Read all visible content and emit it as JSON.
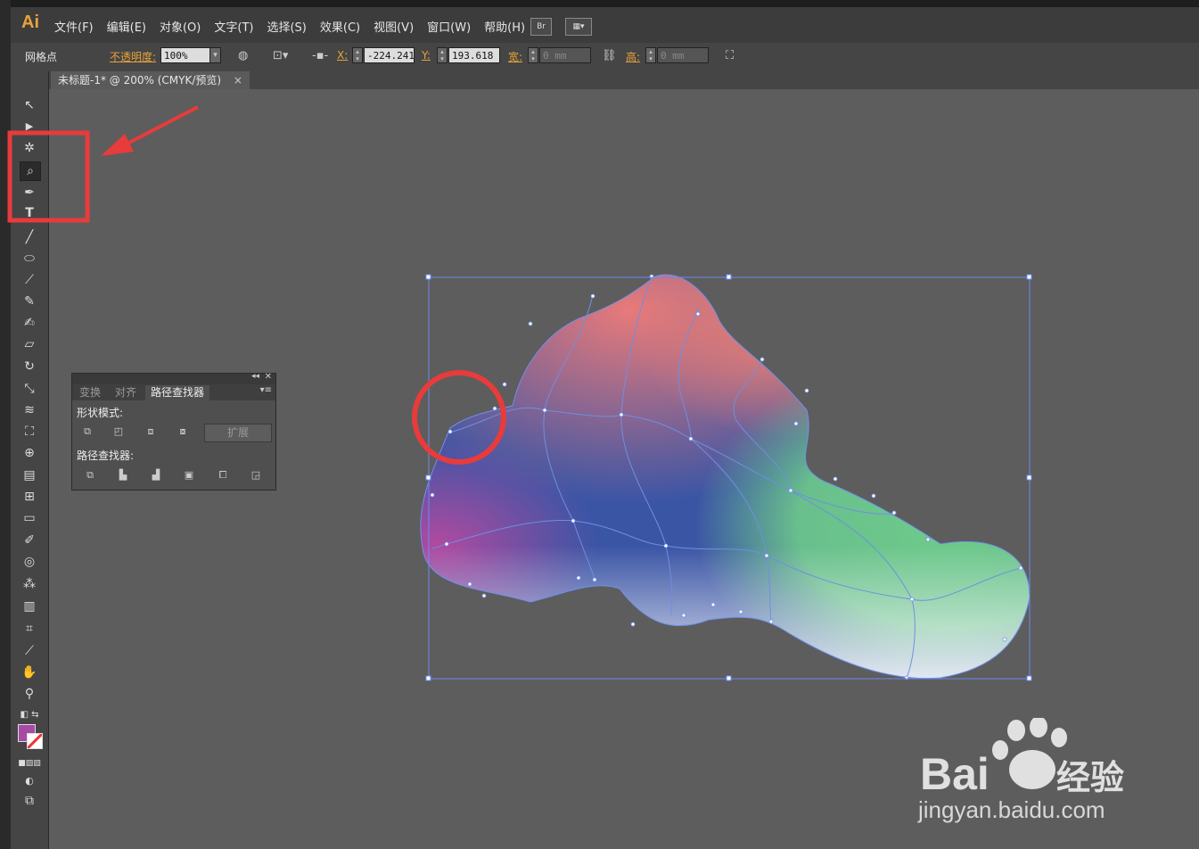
{
  "app": {
    "logo": "Ai"
  },
  "menu": [
    "文件(F)",
    "编辑(E)",
    "对象(O)",
    "文字(T)",
    "选择(S)",
    "效果(C)",
    "视图(V)",
    "窗口(W)",
    "帮助(H)"
  ],
  "menu_icons": {
    "bridge": "Br",
    "arrange": "arrange-documents-icon"
  },
  "control": {
    "selection_label": "网格点",
    "opacity_label": "不透明度:",
    "opacity_value": "100%",
    "x_label": "X:",
    "x_value": "-224.241",
    "y_label": "Y:",
    "y_value": "193.618 r",
    "w_label": "宽:",
    "w_value": "0 mm",
    "h_label": "高:",
    "h_value": "0 mm"
  },
  "doc_tab": {
    "title": "未标题-1* @ 200% (CMYK/预览)",
    "close": "×"
  },
  "panel": {
    "tabs": [
      "变换",
      "对齐",
      "路径查找器"
    ],
    "shape_modes_label": "形状模式:",
    "expand_label": "扩展",
    "pathfinder_label": "路径查找器:"
  },
  "colors": {
    "accent": "#e8a23b",
    "annotation_red": "#e83b3b",
    "fill_swatch": "#a64aa6"
  },
  "watermark": {
    "brand_text": "Bai",
    "brand_cn": "经验",
    "url": "jingyan.baidu.com"
  }
}
